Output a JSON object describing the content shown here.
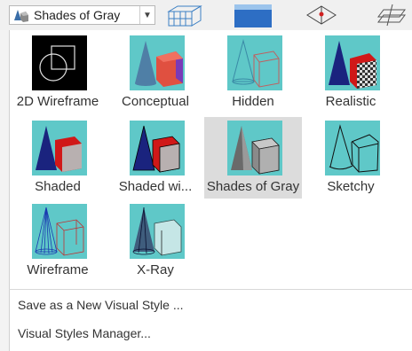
{
  "toolbar": {
    "current_style": "Shades of Gray",
    "icons": [
      "visual-style-cube-icon",
      "box-wireframe-icon",
      "blue-box-icon",
      "ucs-cube-icon",
      "stacked-planes-icon"
    ]
  },
  "styles": [
    {
      "label": "2D Wireframe",
      "icon": "2d-wireframe-icon",
      "selected": false
    },
    {
      "label": "Conceptual",
      "icon": "conceptual-icon",
      "selected": false
    },
    {
      "label": "Hidden",
      "icon": "hidden-icon",
      "selected": false
    },
    {
      "label": "Realistic",
      "icon": "realistic-icon",
      "selected": false
    },
    {
      "label": "Shaded",
      "icon": "shaded-icon",
      "selected": false
    },
    {
      "label": "Shaded wi...",
      "icon": "shaded-with-edges-icon",
      "selected": false
    },
    {
      "label": "Shades of Gray",
      "icon": "shades-of-gray-icon",
      "selected": true
    },
    {
      "label": "Sketchy",
      "icon": "sketchy-icon",
      "selected": false
    },
    {
      "label": "Wireframe",
      "icon": "wireframe-icon",
      "selected": false
    },
    {
      "label": "X-Ray",
      "icon": "x-ray-icon",
      "selected": false
    }
  ],
  "menu": {
    "save_new": "Save as a New Visual Style ...",
    "manager": "Visual Styles Manager..."
  },
  "colors": {
    "thumb_bg": "#5fc8c8",
    "selected_bg": "#dcdcdc",
    "cone_blue": "#1a237e",
    "cube_red": "#d01818"
  }
}
